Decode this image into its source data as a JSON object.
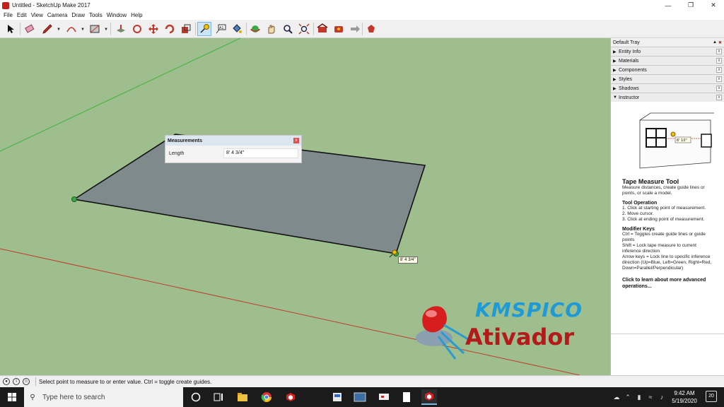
{
  "window": {
    "title": "Untitled - SketchUp Make 2017"
  },
  "menu": [
    "File",
    "Edit",
    "View",
    "Camera",
    "Draw",
    "Tools",
    "Window",
    "Help"
  ],
  "toolbar": {
    "tools": [
      "select-icon",
      "eraser-icon",
      "pencil-icon",
      "arc-icon",
      "rectangle-icon",
      "push-pull-icon",
      "follow-me-icon",
      "move-icon",
      "rotate-icon",
      "scale-icon",
      "tape-measure-icon",
      "text-icon",
      "paint-bucket-icon",
      "orbit-icon",
      "pan-icon",
      "zoom-icon",
      "zoom-extents-icon",
      "warehouse-icon",
      "extension-warehouse-icon",
      "send-to-layout-icon",
      "extension-manager-icon"
    ],
    "active_tool": "tape-measure-icon"
  },
  "measurements": {
    "title": "Measurements",
    "label": "Length",
    "value": "8' 4 3/4\""
  },
  "tooltip": {
    "text": "8' 4 3/4\""
  },
  "watermark": {
    "line1": "KMSPICO",
    "line2": "Ativador"
  },
  "tray": {
    "title": "Default Tray",
    "panels": [
      {
        "label": "Entity Info",
        "expanded": false
      },
      {
        "label": "Materials",
        "expanded": false
      },
      {
        "label": "Components",
        "expanded": false
      },
      {
        "label": "Styles",
        "expanded": false
      },
      {
        "label": "Shadows",
        "expanded": false
      },
      {
        "label": "Instructor",
        "expanded": true
      }
    ],
    "instructor": {
      "image_label": "6' 10\"",
      "tool_name": "Tape Measure Tool",
      "tool_desc": "Measure distances, create guide lines or points, or scale a model.",
      "operation_heading": "Tool Operation",
      "operation_steps": [
        "1. Click at starting point of measurement.",
        "2. Move cursor.",
        "3. Click at ending point of measurement."
      ],
      "modifier_heading": "Modifier Keys",
      "modifier_lines": [
        "Ctrl = Toggles create guide lines or guide points",
        "Shift = Lock tape measure to current inference direction",
        "Arrow keys = Lock line to specific inference direction (Up=Blue, Left=Green, Right=Red, Down=Parallel/Perpendicular)"
      ],
      "more": "Click to learn about more advanced operations..."
    }
  },
  "status": {
    "text": "Select point to measure to or enter value.  Ctrl = toggle create guides."
  },
  "taskbar": {
    "search_placeholder": "Type here to search",
    "time": "9:42 AM",
    "date": "5/19/2020",
    "notification_count": "20"
  },
  "colors": {
    "viewport": "#9ebe8e",
    "face": "#7f8a8c",
    "red_axis": "#c03c2c",
    "green_axis": "#3cb43c",
    "accent": "#7ab6e4"
  }
}
